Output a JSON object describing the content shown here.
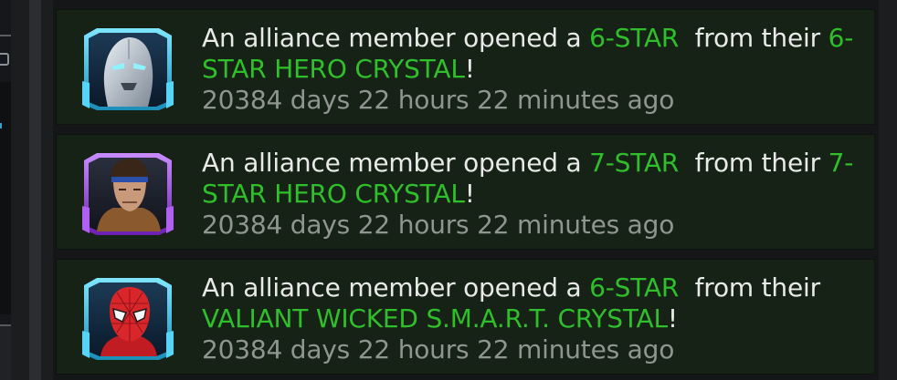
{
  "feed": {
    "items": [
      {
        "hero_icon": "silver-armored-hero-portrait",
        "frame_color": "#36c6e8",
        "prefix": "An alliance member opened a ",
        "star": "6-STAR",
        "middle": "  from their ",
        "crystal": "6-STAR HERO CRYSTAL",
        "suffix": "!",
        "time": "20384 days 22 hours 22 minutes ago"
      },
      {
        "hero_icon": "headband-hero-portrait",
        "frame_color": "#9b3fe0",
        "prefix": "An alliance member opened a ",
        "star": "7-STAR",
        "middle": "  from their ",
        "crystal": "7-STAR HERO CRYSTAL",
        "suffix": "!",
        "time": "20384 days 22 hours 22 minutes ago"
      },
      {
        "hero_icon": "spider-hero-portrait",
        "frame_color": "#36c6e8",
        "prefix": "An alliance member opened a ",
        "star": "6-STAR",
        "middle": "  from their ",
        "crystal": "VALIANT WICKED S.M.A.R.T. CRYSTAL",
        "suffix": "!",
        "time": "20384 days 22 hours 22 minutes ago"
      }
    ]
  }
}
